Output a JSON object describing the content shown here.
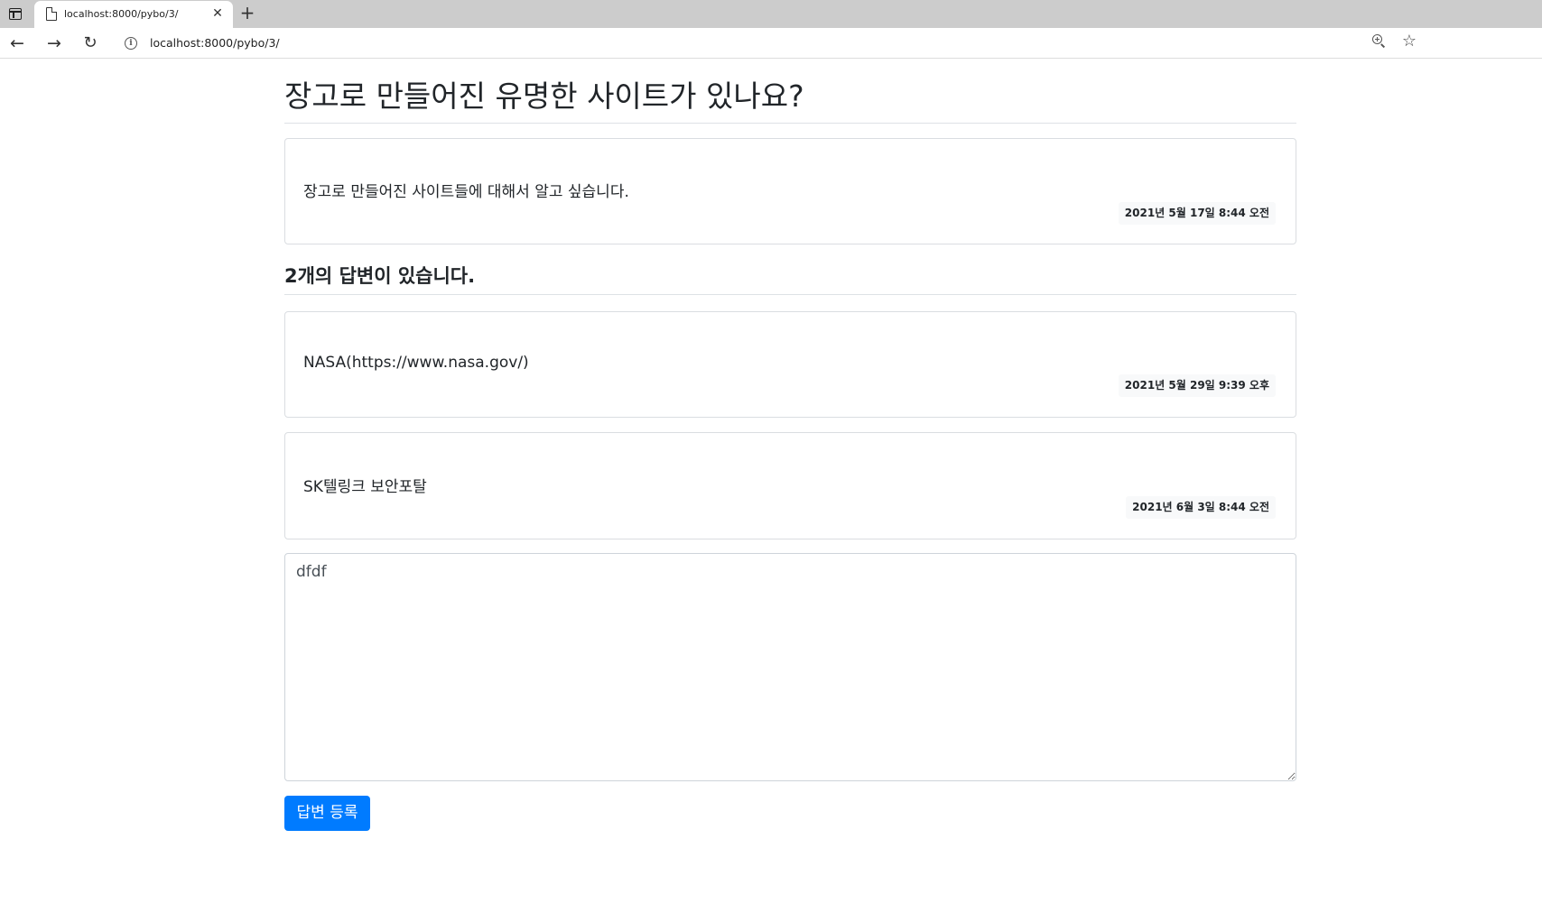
{
  "browser": {
    "tab_title": "localhost:8000/pybo/3/",
    "tab_close": "✕",
    "new_tab": "+",
    "url": "localhost:8000/pybo/3/",
    "icons": {
      "back": "←",
      "forward": "→",
      "reload": "↻",
      "info": "i",
      "favorite": "☆"
    }
  },
  "question": {
    "title": "장고로 만들어진 유명한 사이트가 있나요?",
    "content": "장고로 만들어진 사이트들에 대해서 알고 싶습니다.",
    "date": "2021년 5월 17일 8:44 오전"
  },
  "answers_header": "2개의 답변이 있습니다.",
  "answers": [
    {
      "content": "NASA(https://www.nasa.gov/)",
      "date": "2021년 5월 29일 9:39 오후"
    },
    {
      "content": "SK텔링크 보안포탈",
      "date": "2021년 6월 3일 8:44 오전"
    }
  ],
  "answer_form": {
    "value": "dfdf",
    "submit_label": "답변 등록"
  },
  "colors": {
    "primary_button": "#007bff",
    "date_badge_bg": "#f8f9fa",
    "tabstrip_bg": "#cccccc"
  }
}
